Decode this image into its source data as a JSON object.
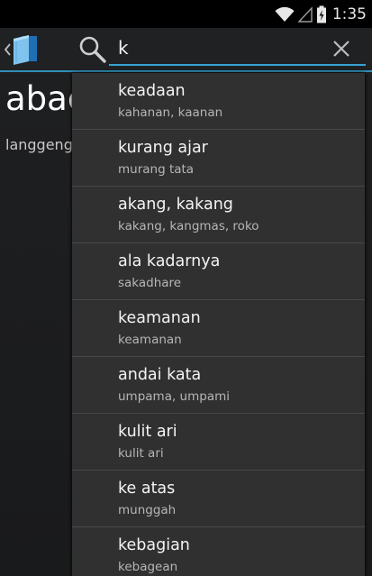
{
  "status_bar": {
    "time": "1:35",
    "icons": [
      "wifi-icon",
      "signal-icon",
      "battery-icon"
    ]
  },
  "action_bar": {
    "up_icon": "book-icon",
    "search_icon": "search-icon",
    "search_query": "k",
    "clear_icon": "close-icon",
    "accent_color": "#36a3d3"
  },
  "detail": {
    "word": "abac",
    "meaning": "langgeng"
  },
  "suggestions": [
    {
      "term": "keadaan",
      "meaning": "kahanan, kaanan"
    },
    {
      "term": "kurang ajar",
      "meaning": "murang tata"
    },
    {
      "term": "akang, kakang",
      "meaning": "kakang, kangmas, roko"
    },
    {
      "term": "ala kadarnya",
      "meaning": "sakadhare"
    },
    {
      "term": "keamanan",
      "meaning": "keamanan"
    },
    {
      "term": "andai kata",
      "meaning": "umpama, umpami"
    },
    {
      "term": "kulit ari",
      "meaning": "kulit ari"
    },
    {
      "term": "ke atas",
      "meaning": "munggah"
    },
    {
      "term": "kebagian",
      "meaning": "kebagean"
    }
  ]
}
